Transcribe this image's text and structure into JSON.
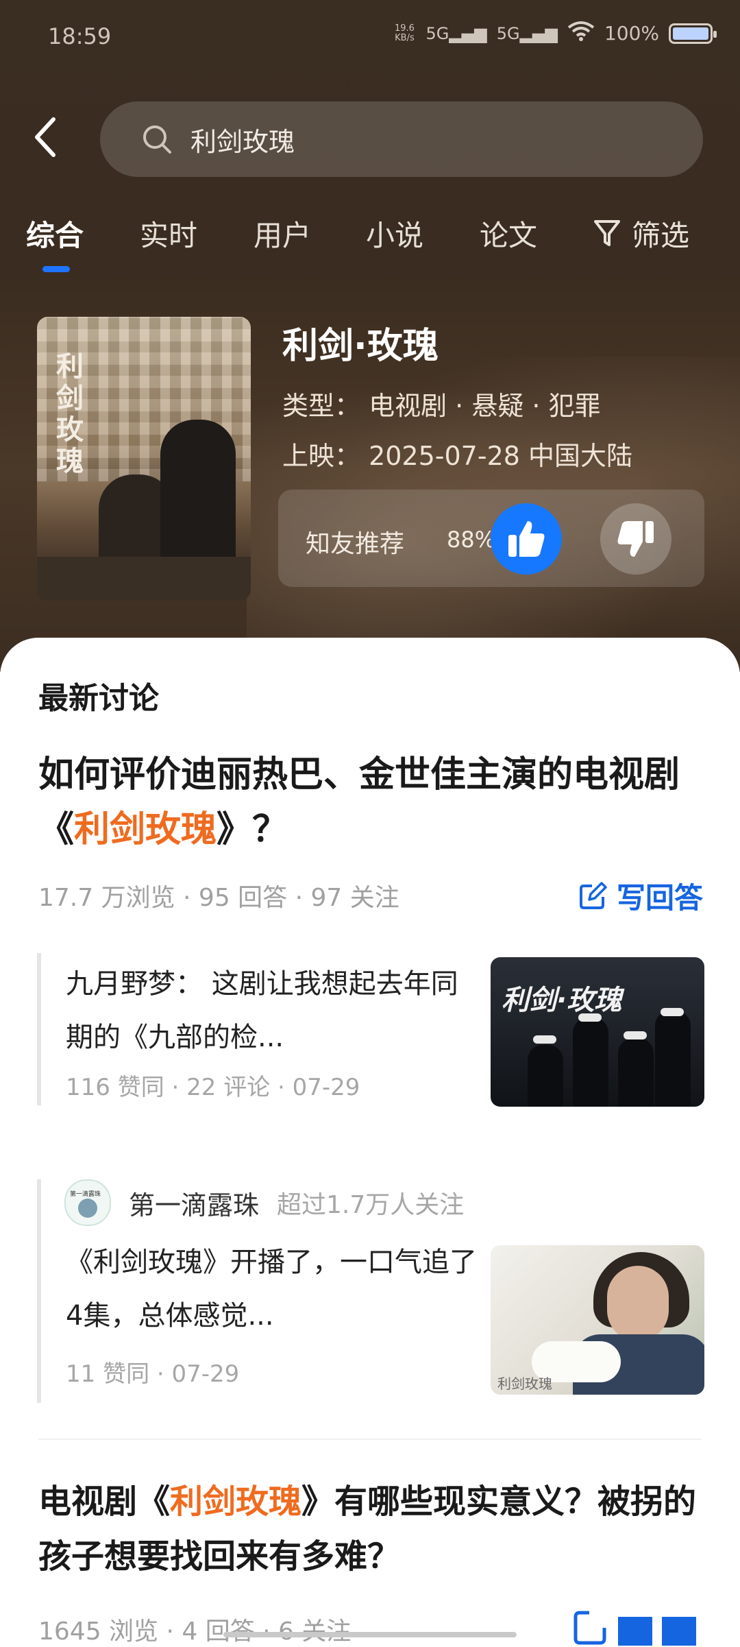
{
  "status_bar": {
    "time": "18:59",
    "net_speed_top": "19.6",
    "net_speed_bottom": "KB/s",
    "sim1": "5G",
    "sim2": "5G",
    "battery": "100%"
  },
  "search": {
    "query": "利剑玫瑰"
  },
  "tabs": [
    {
      "label": "综合"
    },
    {
      "label": "实时"
    },
    {
      "label": "用户"
    },
    {
      "label": "小说"
    },
    {
      "label": "论文"
    }
  ],
  "filter_label": "筛选",
  "show": {
    "poster_title": "利剑玫瑰",
    "title": "利剑·玫瑰",
    "genre": "类型： 电视剧 · 悬疑 · 犯罪",
    "release": "上映： 2025-07-28 中国大陆",
    "recommend_label": "知友推荐",
    "recommend_pct": "88%"
  },
  "discussion": {
    "section_title": "最新讨论",
    "q1": {
      "title_pre": "如何评价迪丽热巴、金世佳主演的电视剧《",
      "title_hl": "利剑玫瑰",
      "title_post": "》？",
      "stats": "17.7 万浏览 · 95 回答 · 97 关注",
      "write_label": "写回答"
    },
    "answer1": {
      "text": "九月野梦： 这剧让我想起去年同期的《九部的检...",
      "stats": "116 赞同 · 22 评论 · 07-29",
      "thumb_title": "利剑·玫瑰"
    },
    "answer2": {
      "author": "第一滴露珠",
      "followers": "超过1.7万人关注",
      "avatar_text": "第一滴露珠",
      "text": "《利剑玫瑰》开播了，一口气追了4集，总体感觉...",
      "stats": "11 赞同 · 07-29",
      "thumb_title": "利剑玫瑰"
    },
    "q2": {
      "title_pre": "电视剧《",
      "title_hl": "利剑玫瑰",
      "title_post": "》有哪些现实意义？被拐的孩子想要找回来有多难？",
      "stats": "1645 浏览 · 4 回答 · 6 关注"
    }
  },
  "colors": {
    "accent": "#1677ff",
    "highlight": "#ef6b1f",
    "hero_bg": "#3a2d22"
  }
}
